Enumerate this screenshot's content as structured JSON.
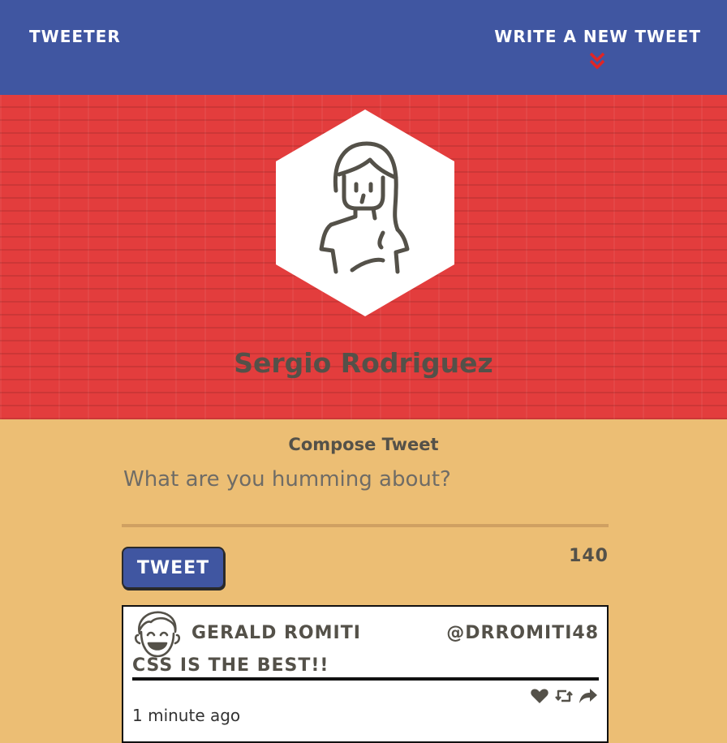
{
  "nav": {
    "brand": "Tweeter",
    "write_label": "Write a new tweet"
  },
  "profile": {
    "name": "Sergio Rodriguez"
  },
  "compose": {
    "title": "Compose Tweet",
    "placeholder": "What are you humming about?",
    "button_label": "Tweet",
    "counter": "140"
  },
  "tweets": [
    {
      "author": "Gerald Romiti",
      "handle": "@DrRomiti48",
      "content": "CSS is the best!!",
      "timestamp": "1 minute ago"
    }
  ],
  "icons": {
    "write_indicator": "double-chevron-down-icon",
    "actions": [
      "heart-icon",
      "retweet-icon",
      "share-icon"
    ]
  },
  "colors": {
    "nav": "#4056a1",
    "header": "#e33d3d",
    "page": "#ecbe74",
    "text": "#545149",
    "accent": "#e02525"
  }
}
